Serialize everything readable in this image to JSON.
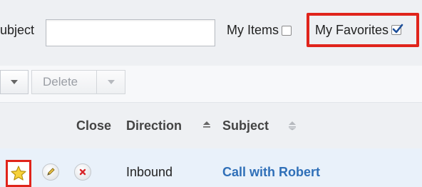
{
  "filters": {
    "subject_label": "ubject",
    "subject_value": "",
    "my_items_label": "My Items",
    "my_items_checked": false,
    "my_favorites_label": "My Favorites",
    "my_favorites_checked": true
  },
  "actions": {
    "delete_label": "Delete"
  },
  "table": {
    "columns": [
      {
        "label": "Close"
      },
      {
        "label": "Direction"
      },
      {
        "label": "Subject"
      }
    ],
    "rows": [
      {
        "favorite": true,
        "direction": "Inbound",
        "subject": "Call with Robert"
      }
    ]
  },
  "colors": {
    "highlight": "#e0241b",
    "link": "#2f6fb8",
    "row_background": "#e9f1fa"
  },
  "icons": {
    "favorite": "star-icon",
    "edit": "pencil-icon",
    "close": "close-x-icon",
    "sort": "sort-icon",
    "dropdown": "chevron-down-icon",
    "checked": "checkmark-icon"
  }
}
